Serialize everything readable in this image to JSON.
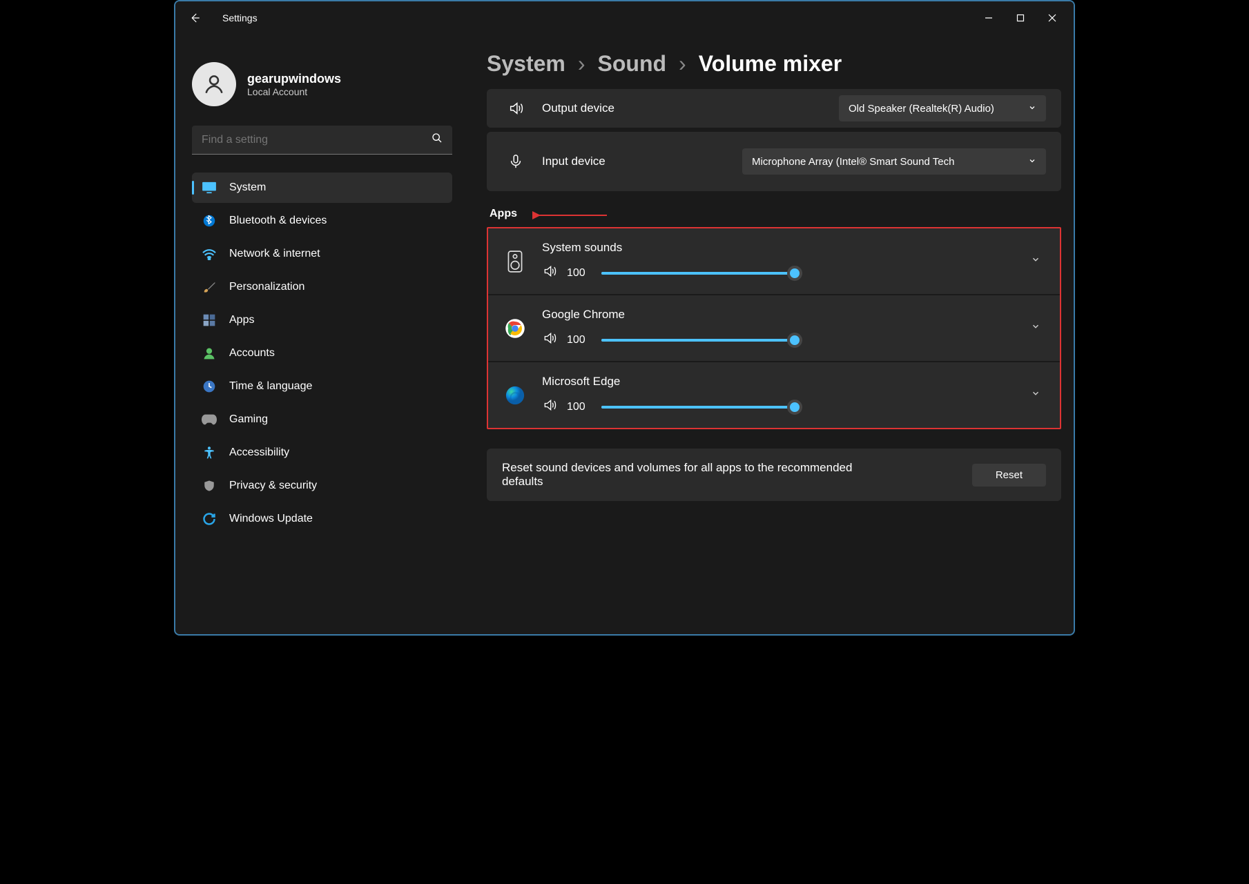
{
  "window": {
    "title": "Settings"
  },
  "profile": {
    "name": "gearupwindows",
    "sub": "Local Account"
  },
  "search": {
    "placeholder": "Find a setting"
  },
  "nav": [
    {
      "label": "System",
      "icon": "display",
      "active": true
    },
    {
      "label": "Bluetooth & devices",
      "icon": "bluetooth"
    },
    {
      "label": "Network & internet",
      "icon": "wifi"
    },
    {
      "label": "Personalization",
      "icon": "brush"
    },
    {
      "label": "Apps",
      "icon": "apps"
    },
    {
      "label": "Accounts",
      "icon": "person"
    },
    {
      "label": "Time & language",
      "icon": "clock"
    },
    {
      "label": "Gaming",
      "icon": "gamepad"
    },
    {
      "label": "Accessibility",
      "icon": "accessibility"
    },
    {
      "label": "Privacy & security",
      "icon": "shield"
    },
    {
      "label": "Windows Update",
      "icon": "update"
    }
  ],
  "breadcrumb": {
    "a": "System",
    "b": "Sound",
    "c": "Volume mixer"
  },
  "devices": {
    "output": {
      "label": "Output device",
      "value": "Old Speaker (Realtek(R) Audio)"
    },
    "input": {
      "label": "Input device",
      "value": "Microphone Array (Intel® Smart Sound Tech"
    }
  },
  "apps_section": "Apps",
  "apps": [
    {
      "name": "System sounds",
      "volume": 100,
      "icon": "speaker-device"
    },
    {
      "name": "Google Chrome",
      "volume": 100,
      "icon": "chrome"
    },
    {
      "name": "Microsoft Edge",
      "volume": 100,
      "icon": "edge"
    }
  ],
  "reset": {
    "text": "Reset sound devices and volumes for all apps to the recommended defaults",
    "button": "Reset"
  }
}
